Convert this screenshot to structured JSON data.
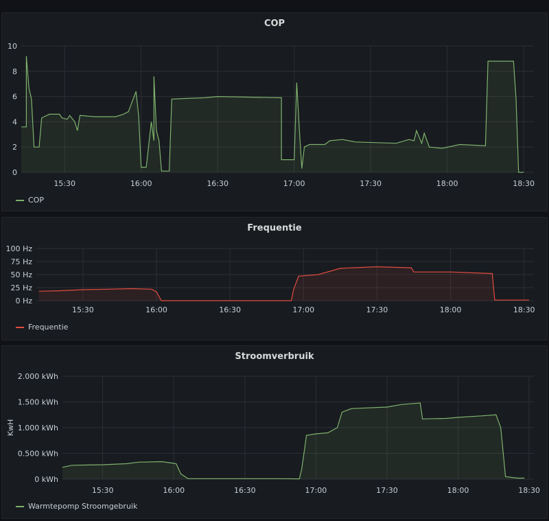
{
  "chart_data": [
    {
      "type": "area",
      "title": "COP",
      "ylabel": "",
      "ylim": [
        0,
        10
      ],
      "xlim": [
        "15:13",
        "18:34"
      ],
      "y_ticks": [
        "0",
        "2",
        "4",
        "6",
        "8",
        "10"
      ],
      "x_ticks": [
        "15:30",
        "16:00",
        "16:30",
        "17:00",
        "17:30",
        "18:00",
        "18:30"
      ],
      "grid": true,
      "legend_position": "bottom-left",
      "color": "#7eb26d",
      "series": [
        {
          "name": "COP",
          "points": [
            [
              "15:13",
              3.6
            ],
            [
              "15:15",
              3.6
            ],
            [
              "15:15",
              9.2
            ],
            [
              "15:16",
              6.7
            ],
            [
              "15:17",
              5.8
            ],
            [
              "15:18",
              2.0
            ],
            [
              "15:20",
              2.0
            ],
            [
              "15:21",
              4.3
            ],
            [
              "15:22",
              4.4
            ],
            [
              "15:24",
              4.6
            ],
            [
              "15:28",
              4.6
            ],
            [
              "15:29",
              4.3
            ],
            [
              "15:31",
              4.2
            ],
            [
              "15:32",
              4.5
            ],
            [
              "15:34",
              4.0
            ],
            [
              "15:35",
              3.3
            ],
            [
              "15:36",
              4.5
            ],
            [
              "15:42",
              4.4
            ],
            [
              "15:50",
              4.4
            ],
            [
              "15:53",
              4.6
            ],
            [
              "15:55",
              4.8
            ],
            [
              "15:58",
              6.4
            ],
            [
              "15:59",
              4.5
            ],
            [
              "16:00",
              0.4
            ],
            [
              "16:02",
              0.4
            ],
            [
              "16:04",
              4.0
            ],
            [
              "16:05",
              2.5
            ],
            [
              "16:05",
              7.6
            ],
            [
              "16:06",
              3.3
            ],
            [
              "16:07",
              2.5
            ],
            [
              "16:08",
              0.1
            ],
            [
              "16:11",
              0.1
            ],
            [
              "16:12",
              5.8
            ],
            [
              "16:25",
              5.9
            ],
            [
              "16:30",
              6.0
            ],
            [
              "16:55",
              5.9
            ],
            [
              "16:55",
              1.0
            ],
            [
              "17:00",
              1.0
            ],
            [
              "17:01",
              7.1
            ],
            [
              "17:02",
              3.5
            ],
            [
              "17:03",
              0.3
            ],
            [
              "17:04",
              2.0
            ],
            [
              "17:06",
              2.2
            ],
            [
              "17:12",
              2.2
            ],
            [
              "17:14",
              2.5
            ],
            [
              "17:19",
              2.6
            ],
            [
              "17:24",
              2.4
            ],
            [
              "17:40",
              2.3
            ],
            [
              "17:45",
              2.6
            ],
            [
              "17:47",
              2.5
            ],
            [
              "17:48",
              3.3
            ],
            [
              "17:50",
              2.3
            ],
            [
              "17:51",
              3.1
            ],
            [
              "17:53",
              2.0
            ],
            [
              "17:58",
              1.9
            ],
            [
              "18:05",
              2.2
            ],
            [
              "18:15",
              2.1
            ],
            [
              "18:16",
              8.8
            ],
            [
              "18:26",
              8.8
            ],
            [
              "18:27",
              5.8
            ],
            [
              "18:28",
              0.0
            ],
            [
              "18:30",
              0.0
            ]
          ]
        }
      ]
    },
    {
      "type": "area",
      "title": "Frequentie",
      "ylabel": "",
      "ylim": [
        0,
        100
      ],
      "xlim": [
        "15:11",
        "18:34"
      ],
      "y_ticks": [
        "0 Hz",
        "25 Hz",
        "50 Hz",
        "75 Hz",
        "100 Hz"
      ],
      "x_ticks": [
        "15:30",
        "16:00",
        "16:30",
        "17:00",
        "17:30",
        "18:00",
        "18:30"
      ],
      "grid": true,
      "legend_position": "bottom-left",
      "color": "#e24d42",
      "series": [
        {
          "name": "Frequentie",
          "points": [
            [
              "15:12",
              18
            ],
            [
              "15:20",
              19
            ],
            [
              "15:30",
              21
            ],
            [
              "15:40",
              22
            ],
            [
              "15:50",
              23
            ],
            [
              "15:58",
              22
            ],
            [
              "16:00",
              17
            ],
            [
              "16:02",
              0
            ],
            [
              "16:55",
              0
            ],
            [
              "16:56",
              22
            ],
            [
              "16:58",
              47
            ],
            [
              "17:06",
              50
            ],
            [
              "17:15",
              62
            ],
            [
              "17:30",
              65
            ],
            [
              "17:44",
              63
            ],
            [
              "17:45",
              55
            ],
            [
              "18:00",
              55
            ],
            [
              "18:17",
              52
            ],
            [
              "18:18",
              1
            ],
            [
              "18:32",
              1
            ]
          ]
        }
      ]
    },
    {
      "type": "area",
      "title": "Stroomverbruik",
      "ylabel": "KwH",
      "ylim": [
        0,
        2000
      ],
      "xlim": [
        "15:13",
        "18:32"
      ],
      "y_ticks": [
        "0 kWh",
        "0.500 kWh",
        "1.000 kWh",
        "1.500 kWh",
        "2.000 kWh"
      ],
      "x_ticks": [
        "15:30",
        "16:00",
        "16:30",
        "17:00",
        "17:30",
        "18:00",
        "18:30"
      ],
      "grid": true,
      "legend_position": "bottom-left",
      "color": "#7eb26d",
      "series": [
        {
          "name": "Warmtepomp Stroomgebruik",
          "points": [
            [
              "15:13",
              230
            ],
            [
              "15:17",
              270
            ],
            [
              "15:30",
              280
            ],
            [
              "15:40",
              300
            ],
            [
              "15:45",
              330
            ],
            [
              "15:55",
              340
            ],
            [
              "15:58",
              320
            ],
            [
              "16:01",
              300
            ],
            [
              "16:03",
              100
            ],
            [
              "16:06",
              10
            ],
            [
              "16:45",
              10
            ],
            [
              "16:53",
              5
            ],
            [
              "16:54",
              200
            ],
            [
              "16:56",
              850
            ],
            [
              "17:00",
              880
            ],
            [
              "17:05",
              900
            ],
            [
              "17:09",
              1000
            ],
            [
              "17:11",
              1300
            ],
            [
              "17:15",
              1370
            ],
            [
              "17:30",
              1400
            ],
            [
              "17:36",
              1450
            ],
            [
              "17:44",
              1480
            ],
            [
              "17:45",
              1170
            ],
            [
              "17:55",
              1180
            ],
            [
              "18:00",
              1200
            ],
            [
              "18:10",
              1230
            ],
            [
              "18:16",
              1250
            ],
            [
              "18:18",
              1000
            ],
            [
              "18:20",
              50
            ],
            [
              "18:25",
              20
            ],
            [
              "18:28",
              20
            ]
          ]
        }
      ]
    }
  ]
}
